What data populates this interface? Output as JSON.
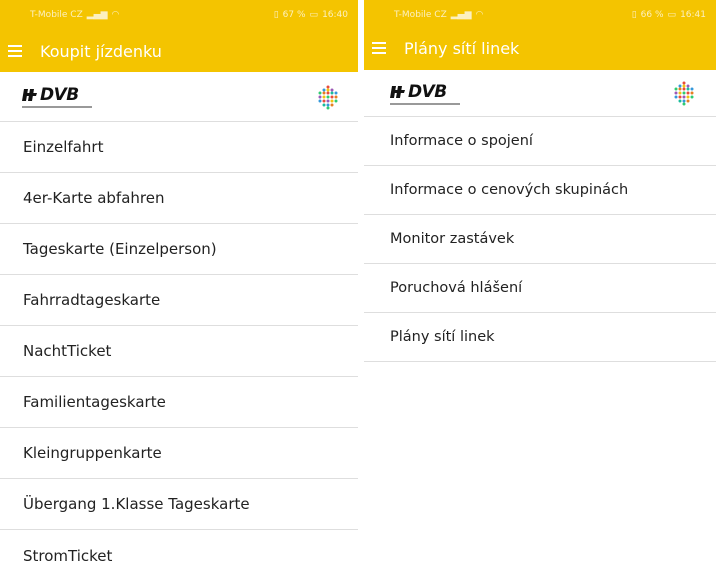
{
  "colors": {
    "brand_yellow": "#f4c400",
    "divider": "#dedede",
    "text": "#222222"
  },
  "left": {
    "status": {
      "carrier": "T-Mobile CZ",
      "battery": "67 %",
      "time": "16:40"
    },
    "appbar": {
      "title": "Koupit jízdenku",
      "menu_icon": "hamburger-icon"
    },
    "logo": {
      "text": "DVB",
      "icon": "dvb-dots-icon"
    },
    "items": [
      "Einzelfahrt",
      "4er-Karte abfahren",
      "Tageskarte (Einzelperson)",
      "Fahrradtageskarte",
      "NachtTicket",
      "Familientageskarte",
      "Kleingruppenkarte",
      "Übergang 1.Klasse Tageskarte",
      "StromTicket"
    ]
  },
  "right": {
    "status": {
      "carrier": "T-Mobile CZ",
      "battery": "66 %",
      "time": "16:41"
    },
    "appbar": {
      "title": "Plány sítí linek",
      "menu_icon": "hamburger-icon"
    },
    "logo": {
      "text": "DVB",
      "icon": "dvb-dots-icon"
    },
    "items": [
      "Informace o spojení",
      "Informace o cenových skupinách",
      "Monitor zastávek",
      "Poruchová hlášení",
      "Plány sítí linek"
    ]
  }
}
